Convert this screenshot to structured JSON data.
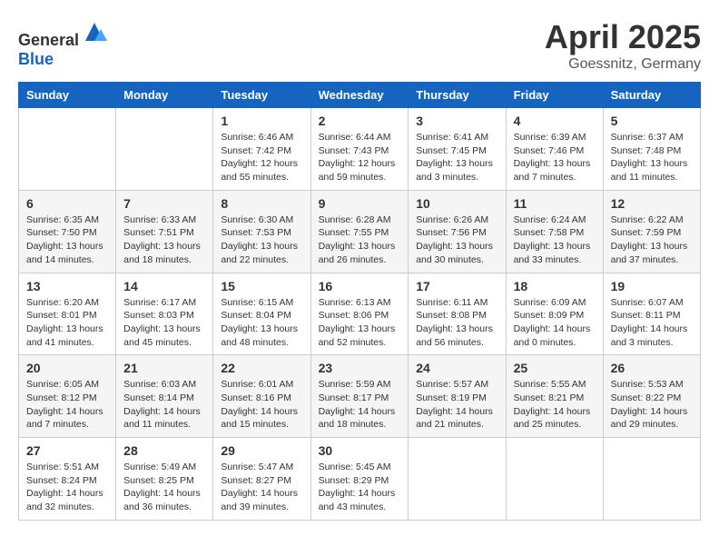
{
  "logo": {
    "general": "General",
    "blue": "Blue"
  },
  "title": "April 2025",
  "location": "Goessnitz, Germany",
  "weekdays": [
    "Sunday",
    "Monday",
    "Tuesday",
    "Wednesday",
    "Thursday",
    "Friday",
    "Saturday"
  ],
  "weeks": [
    [
      {
        "day": "",
        "detail": ""
      },
      {
        "day": "",
        "detail": ""
      },
      {
        "day": "1",
        "detail": "Sunrise: 6:46 AM\nSunset: 7:42 PM\nDaylight: 12 hours\nand 55 minutes."
      },
      {
        "day": "2",
        "detail": "Sunrise: 6:44 AM\nSunset: 7:43 PM\nDaylight: 12 hours\nand 59 minutes."
      },
      {
        "day": "3",
        "detail": "Sunrise: 6:41 AM\nSunset: 7:45 PM\nDaylight: 13 hours\nand 3 minutes."
      },
      {
        "day": "4",
        "detail": "Sunrise: 6:39 AM\nSunset: 7:46 PM\nDaylight: 13 hours\nand 7 minutes."
      },
      {
        "day": "5",
        "detail": "Sunrise: 6:37 AM\nSunset: 7:48 PM\nDaylight: 13 hours\nand 11 minutes."
      }
    ],
    [
      {
        "day": "6",
        "detail": "Sunrise: 6:35 AM\nSunset: 7:50 PM\nDaylight: 13 hours\nand 14 minutes."
      },
      {
        "day": "7",
        "detail": "Sunrise: 6:33 AM\nSunset: 7:51 PM\nDaylight: 13 hours\nand 18 minutes."
      },
      {
        "day": "8",
        "detail": "Sunrise: 6:30 AM\nSunset: 7:53 PM\nDaylight: 13 hours\nand 22 minutes."
      },
      {
        "day": "9",
        "detail": "Sunrise: 6:28 AM\nSunset: 7:55 PM\nDaylight: 13 hours\nand 26 minutes."
      },
      {
        "day": "10",
        "detail": "Sunrise: 6:26 AM\nSunset: 7:56 PM\nDaylight: 13 hours\nand 30 minutes."
      },
      {
        "day": "11",
        "detail": "Sunrise: 6:24 AM\nSunset: 7:58 PM\nDaylight: 13 hours\nand 33 minutes."
      },
      {
        "day": "12",
        "detail": "Sunrise: 6:22 AM\nSunset: 7:59 PM\nDaylight: 13 hours\nand 37 minutes."
      }
    ],
    [
      {
        "day": "13",
        "detail": "Sunrise: 6:20 AM\nSunset: 8:01 PM\nDaylight: 13 hours\nand 41 minutes."
      },
      {
        "day": "14",
        "detail": "Sunrise: 6:17 AM\nSunset: 8:03 PM\nDaylight: 13 hours\nand 45 minutes."
      },
      {
        "day": "15",
        "detail": "Sunrise: 6:15 AM\nSunset: 8:04 PM\nDaylight: 13 hours\nand 48 minutes."
      },
      {
        "day": "16",
        "detail": "Sunrise: 6:13 AM\nSunset: 8:06 PM\nDaylight: 13 hours\nand 52 minutes."
      },
      {
        "day": "17",
        "detail": "Sunrise: 6:11 AM\nSunset: 8:08 PM\nDaylight: 13 hours\nand 56 minutes."
      },
      {
        "day": "18",
        "detail": "Sunrise: 6:09 AM\nSunset: 8:09 PM\nDaylight: 14 hours\nand 0 minutes."
      },
      {
        "day": "19",
        "detail": "Sunrise: 6:07 AM\nSunset: 8:11 PM\nDaylight: 14 hours\nand 3 minutes."
      }
    ],
    [
      {
        "day": "20",
        "detail": "Sunrise: 6:05 AM\nSunset: 8:12 PM\nDaylight: 14 hours\nand 7 minutes."
      },
      {
        "day": "21",
        "detail": "Sunrise: 6:03 AM\nSunset: 8:14 PM\nDaylight: 14 hours\nand 11 minutes."
      },
      {
        "day": "22",
        "detail": "Sunrise: 6:01 AM\nSunset: 8:16 PM\nDaylight: 14 hours\nand 15 minutes."
      },
      {
        "day": "23",
        "detail": "Sunrise: 5:59 AM\nSunset: 8:17 PM\nDaylight: 14 hours\nand 18 minutes."
      },
      {
        "day": "24",
        "detail": "Sunrise: 5:57 AM\nSunset: 8:19 PM\nDaylight: 14 hours\nand 21 minutes."
      },
      {
        "day": "25",
        "detail": "Sunrise: 5:55 AM\nSunset: 8:21 PM\nDaylight: 14 hours\nand 25 minutes."
      },
      {
        "day": "26",
        "detail": "Sunrise: 5:53 AM\nSunset: 8:22 PM\nDaylight: 14 hours\nand 29 minutes."
      }
    ],
    [
      {
        "day": "27",
        "detail": "Sunrise: 5:51 AM\nSunset: 8:24 PM\nDaylight: 14 hours\nand 32 minutes."
      },
      {
        "day": "28",
        "detail": "Sunrise: 5:49 AM\nSunset: 8:25 PM\nDaylight: 14 hours\nand 36 minutes."
      },
      {
        "day": "29",
        "detail": "Sunrise: 5:47 AM\nSunset: 8:27 PM\nDaylight: 14 hours\nand 39 minutes."
      },
      {
        "day": "30",
        "detail": "Sunrise: 5:45 AM\nSunset: 8:29 PM\nDaylight: 14 hours\nand 43 minutes."
      },
      {
        "day": "",
        "detail": ""
      },
      {
        "day": "",
        "detail": ""
      },
      {
        "day": "",
        "detail": ""
      }
    ]
  ]
}
